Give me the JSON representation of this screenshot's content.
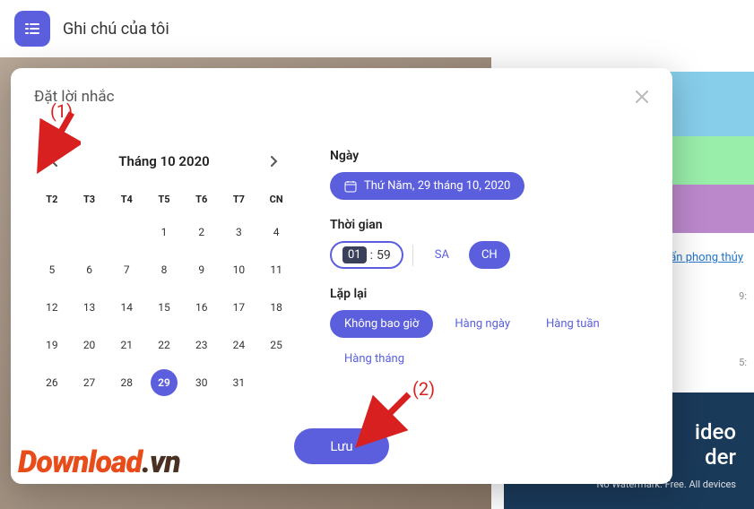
{
  "header": {
    "title": "Ghi chú của tôi"
  },
  "modal": {
    "title": "Đặt lời nhắc",
    "calendar": {
      "month_label": "Tháng 10 2020",
      "weekdays": [
        "T2",
        "T3",
        "T4",
        "T5",
        "T6",
        "T7",
        "CN"
      ],
      "leading_blanks": 3,
      "days": 31,
      "selected": 29
    },
    "date_section": {
      "label": "Ngày",
      "value": "Thứ Năm, 29 tháng 10, 2020"
    },
    "time_section": {
      "label": "Thời gian",
      "hour": "01",
      "minute": "59",
      "am_label": "SA",
      "pm_label": "CH",
      "active": "CH"
    },
    "repeat_section": {
      "label": "Lặp lại",
      "options": [
        "Không bao giờ",
        "Hàng ngày",
        "Hàng tuần",
        "Hàng tháng"
      ],
      "active": "Không bao giờ"
    },
    "save_label": "Lưu"
  },
  "background": {
    "side_link": "uẩn phong thủy",
    "time1": "9:",
    "time2": "5:",
    "ad_title": "ideo",
    "ad_title2": "der",
    "ad_sub": "No Watermark. Free. All devices"
  },
  "annotations": {
    "label1": "(1)",
    "label2": "(2)"
  },
  "watermark": {
    "part1": "Download",
    "part2": ".vn"
  }
}
